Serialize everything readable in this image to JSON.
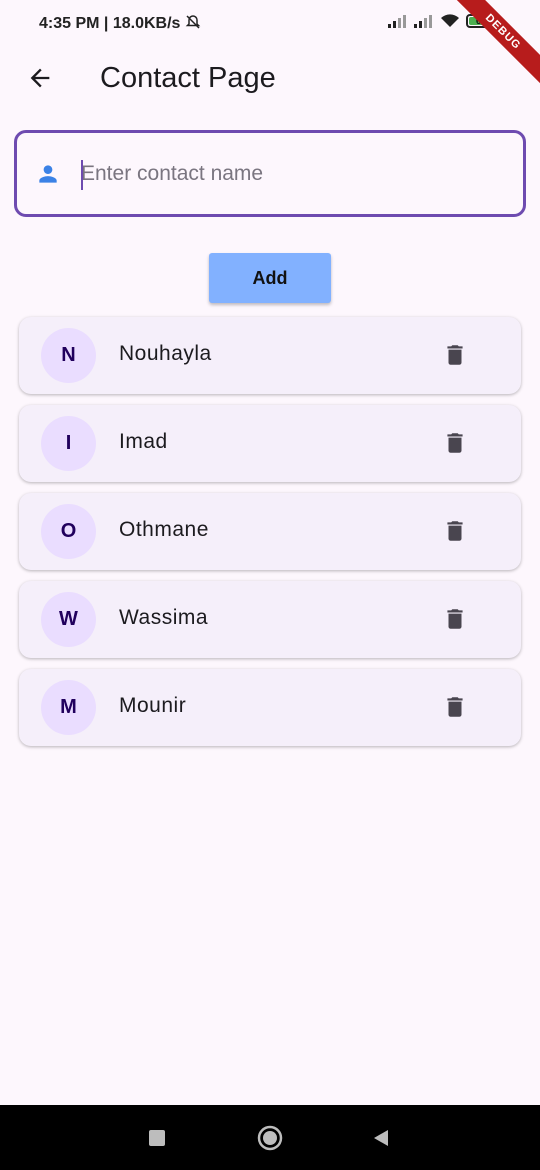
{
  "status_bar": {
    "time": "4:35 PM",
    "network_speed": "18.0KB/s",
    "battery_level": "64",
    "icons": [
      "alarm-off-icon",
      "signal-icon",
      "signal-icon",
      "wifi-icon",
      "battery-icon"
    ]
  },
  "debug_banner": "DEBUG",
  "app_bar": {
    "back_icon": "arrow-back-icon",
    "title": "Contact Page"
  },
  "input": {
    "placeholder": "Enter contact name",
    "value": "",
    "icon": "person-icon"
  },
  "add_button": {
    "label": "Add"
  },
  "contacts": [
    {
      "initial": "N",
      "name": "Nouhayla"
    },
    {
      "initial": "I",
      "name": "Imad"
    },
    {
      "initial": "O",
      "name": "Othmane"
    },
    {
      "initial": "W",
      "name": "Wassima"
    },
    {
      "initial": "M",
      "name": "Mounir"
    }
  ],
  "nav_bar": {
    "buttons": [
      "recents-square-icon",
      "home-circle-icon",
      "back-triangle-icon"
    ]
  },
  "colors": {
    "background": "#fdf7fd",
    "input_border": "#6e4bb0",
    "add_button": "#82b1ff",
    "card": "#f5effa",
    "avatar": "#eaddff",
    "avatar_text": "#21005d",
    "delete_icon": "#49454f",
    "person_icon": "#3b82e6",
    "debug_banner": "#b71c1c"
  }
}
